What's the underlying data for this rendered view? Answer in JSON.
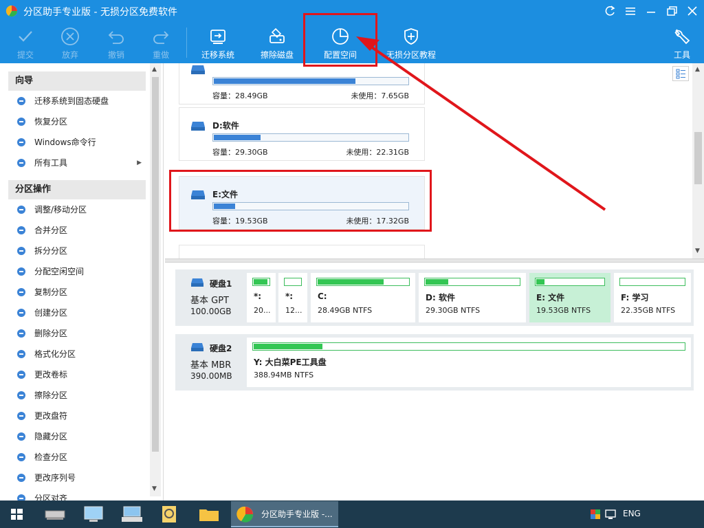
{
  "window": {
    "title": "分区助手专业版 - 无损分区免费软件"
  },
  "toolbar": {
    "commit": "提交",
    "discard": "放弃",
    "undo": "撤销",
    "redo": "重做",
    "migrate_os": "迁移系统",
    "wipe_disk": "擦除磁盘",
    "allocate_space": "配置空间",
    "tutorial": "无损分区教程",
    "tools": "工具"
  },
  "sidebar": {
    "wizard_header": "向导",
    "wizard_items": [
      {
        "label": "迁移系统到固态硬盘",
        "icon": "migrate-ssd-icon"
      },
      {
        "label": "恢复分区",
        "icon": "recover-partition-icon"
      },
      {
        "label": "Windows命令行",
        "icon": "windows-icon"
      },
      {
        "label": "所有工具",
        "icon": "all-tools-icon"
      }
    ],
    "ops_header": "分区操作",
    "ops_items": [
      {
        "label": "调整/移动分区",
        "icon": "resize-icon"
      },
      {
        "label": "合并分区",
        "icon": "merge-icon"
      },
      {
        "label": "拆分分区",
        "icon": "split-icon"
      },
      {
        "label": "分配空闲空间",
        "icon": "allocate-icon"
      },
      {
        "label": "复制分区",
        "icon": "copy-icon"
      },
      {
        "label": "创建分区",
        "icon": "create-icon"
      },
      {
        "label": "删除分区",
        "icon": "delete-icon"
      },
      {
        "label": "格式化分区",
        "icon": "format-icon"
      },
      {
        "label": "更改卷标",
        "icon": "label-icon"
      },
      {
        "label": "擦除分区",
        "icon": "wipe-icon"
      },
      {
        "label": "更改盘符",
        "icon": "drive-letter-icon"
      },
      {
        "label": "隐藏分区",
        "icon": "hide-icon"
      },
      {
        "label": "检查分区",
        "icon": "check-icon"
      },
      {
        "label": "更改序列号",
        "icon": "serial-icon"
      },
      {
        "label": "分区对齐",
        "icon": "align-icon"
      }
    ]
  },
  "cards": [
    {
      "name": "",
      "capacity": "容量：28.49GB",
      "unused": "未使用：7.65GB",
      "used_fraction": 0.73
    },
    {
      "name": "D:软件",
      "capacity": "容量：29.30GB",
      "unused": "未使用：22.31GB",
      "used_fraction": 0.24
    },
    {
      "name": "E:文件",
      "capacity": "容量：19.53GB",
      "unused": "未使用：17.32GB",
      "used_fraction": 0.11
    }
  ],
  "disks": [
    {
      "name": "硬盘1",
      "type": "基本 GPT",
      "size": "100.00GB",
      "partitions": [
        {
          "label": "*:",
          "info": "20...",
          "used_fraction": 0.9
        },
        {
          "label": "*:",
          "info": "12...",
          "used_fraction": 0.0
        },
        {
          "label": "C:",
          "info": "28.49GB NTFS",
          "used_fraction": 0.73
        },
        {
          "label": "D: 软件",
          "info": "29.30GB NTFS",
          "used_fraction": 0.24
        },
        {
          "label": "E: 文件",
          "info": "19.53GB NTFS",
          "used_fraction": 0.12
        },
        {
          "label": "F: 学习",
          "info": "22.35GB NTFS",
          "used_fraction": 0.0
        }
      ]
    },
    {
      "name": "硬盘2",
      "type": "基本 MBR",
      "size": "390.00MB",
      "partitions": [
        {
          "label": "Y: 大白菜PE工具盘",
          "info": "388.94MB NTFS",
          "used_fraction": 0.16
        }
      ]
    }
  ],
  "taskbar": {
    "active_app": "分区助手专业版 -...",
    "lang": "ENG"
  },
  "colors": {
    "accent": "#1c8ee0",
    "highlight": "#e0161b",
    "bar_blue": "#3b83d6",
    "bar_green": "#33c653"
  }
}
